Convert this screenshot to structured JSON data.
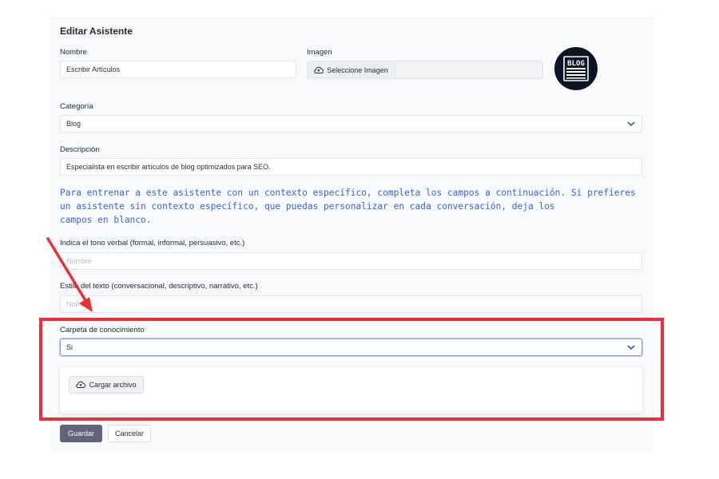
{
  "form": {
    "title": "Editar Asistente",
    "nombre": {
      "label": "Nombre",
      "value": "Escribir Artículos"
    },
    "imagen": {
      "label": "Imagen",
      "button_label": "Seleccione Imagen",
      "logo_text": "BLOG"
    },
    "categoria": {
      "label": "Categoría",
      "value": "Blog"
    },
    "descripcion": {
      "label": "Descripción",
      "value": "Especialista en escribir artículos de blog optimizados para SEO."
    },
    "info_lines": [
      "Para entrenar a este asistente con un contexto específico, completa los campos a continuación. Si prefieres",
      "un asistente sin contexto específico, que puedas personalizar en cada conversación, deja los",
      "campos en blanco."
    ],
    "tono": {
      "label": "Indica el tono verbal (formal, informal, persuasivo, etc.)",
      "placeholder": "Nombre"
    },
    "estilo": {
      "label": "Estilo del texto (conversacional, descriptivo, narrativo, etc.)",
      "placeholder": "Nombre"
    },
    "carpeta": {
      "label": "Carpeta de conocimiento",
      "value": "Si"
    },
    "upload_label": "Cargar archivo",
    "save_label": "Guardar",
    "cancel_label": "Cancelar"
  },
  "colors": {
    "accent_text": "#3a63d6",
    "annotation_red": "#ec2f35",
    "save_button": "#5f6478",
    "logo_bg": "#0c1526"
  },
  "icons": {
    "upload": "cloud-upload-icon",
    "select": "chevron-down-icon",
    "logo": "blog-logo-icon",
    "annotation": "red-arrow-annotation"
  }
}
